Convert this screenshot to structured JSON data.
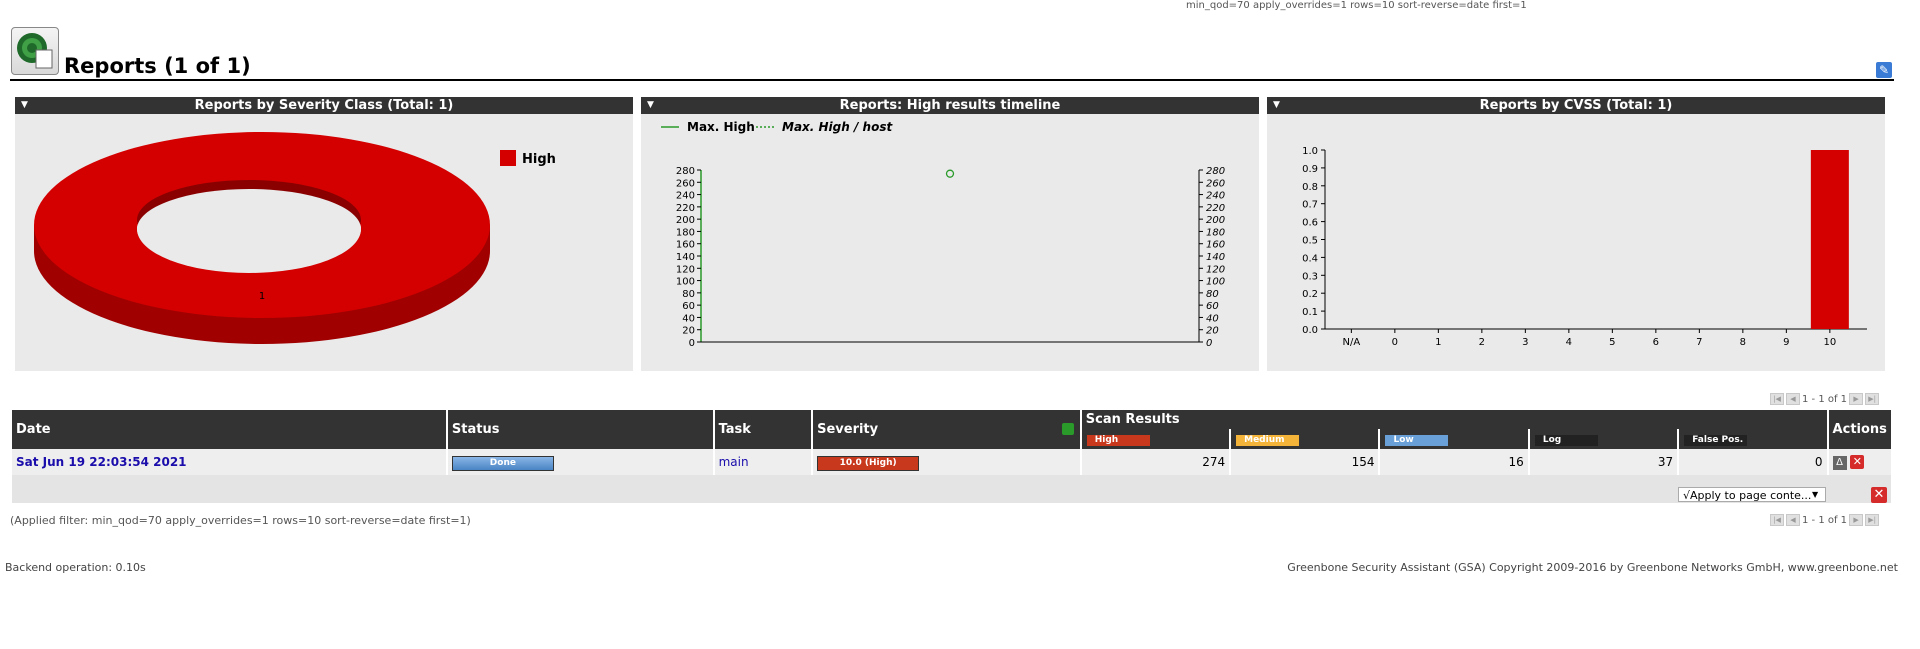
{
  "filter_top": "min_qod=70 apply_overrides=1 rows=10 sort-reverse=date first=1",
  "page_title": "Reports (1 of 1)",
  "panels": {
    "severity": {
      "title": "Reports by Severity Class (Total: 1)",
      "legend": "High",
      "donut_label": "1"
    },
    "timeline": {
      "title": "Reports: High results timeline",
      "legend1": "Max. High",
      "legend2": "Max. High / host"
    },
    "cvss": {
      "title": "Reports by CVSS (Total: 1)"
    }
  },
  "chart_data": [
    {
      "type": "pie",
      "title": "Reports by Severity Class (Total: 1)",
      "categories": [
        "High"
      ],
      "values": [
        1
      ],
      "colors": [
        "#d40000"
      ]
    },
    {
      "type": "line",
      "title": "Reports: High results timeline",
      "series": [
        {
          "name": "Max. High",
          "values": [
            274
          ]
        },
        {
          "name": "Max. High / host",
          "values": [
            274
          ]
        }
      ],
      "yticks": [
        0,
        20,
        40,
        60,
        80,
        100,
        120,
        140,
        160,
        180,
        200,
        220,
        240,
        260,
        280
      ],
      "ylim": [
        0,
        280
      ]
    },
    {
      "type": "bar",
      "title": "Reports by CVSS (Total: 1)",
      "categories": [
        "N/A",
        "0",
        "1",
        "2",
        "3",
        "4",
        "5",
        "6",
        "7",
        "8",
        "9",
        "10"
      ],
      "values": [
        0,
        0,
        0,
        0,
        0,
        0,
        0,
        0,
        0,
        0,
        0,
        1
      ],
      "yticks": [
        "0.0",
        "0.1",
        "0.2",
        "0.3",
        "0.4",
        "0.5",
        "0.6",
        "0.7",
        "0.8",
        "0.9",
        "1.0"
      ],
      "ylim": [
        0,
        1
      ],
      "color": "#d40000"
    }
  ],
  "pager_text": "1 - 1 of 1",
  "table": {
    "headers": {
      "date": "Date",
      "status": "Status",
      "task": "Task",
      "severity": "Severity",
      "scan_results": "Scan Results",
      "actions": "Actions"
    },
    "result_cols": {
      "high": "High",
      "medium": "Medium",
      "low": "Low",
      "log": "Log",
      "false_pos": "False Pos."
    },
    "row": {
      "date": "Sat Jun 19 22:03:54 2021",
      "status": "Done",
      "task": "main",
      "severity": "10.0 (High)",
      "high": "274",
      "medium": "154",
      "low": "16",
      "log": "37",
      "false_pos": "0"
    }
  },
  "apply_select": "√Apply to page conte...",
  "applied_filter": "(Applied filter: min_qod=70 apply_overrides=1 rows=10 sort-reverse=date first=1)",
  "footer": {
    "backend": "Backend operation: 0.10s",
    "copyright": "Greenbone Security Assistant (GSA) Copyright 2009-2016 by Greenbone Networks GmbH, www.greenbone.net"
  }
}
